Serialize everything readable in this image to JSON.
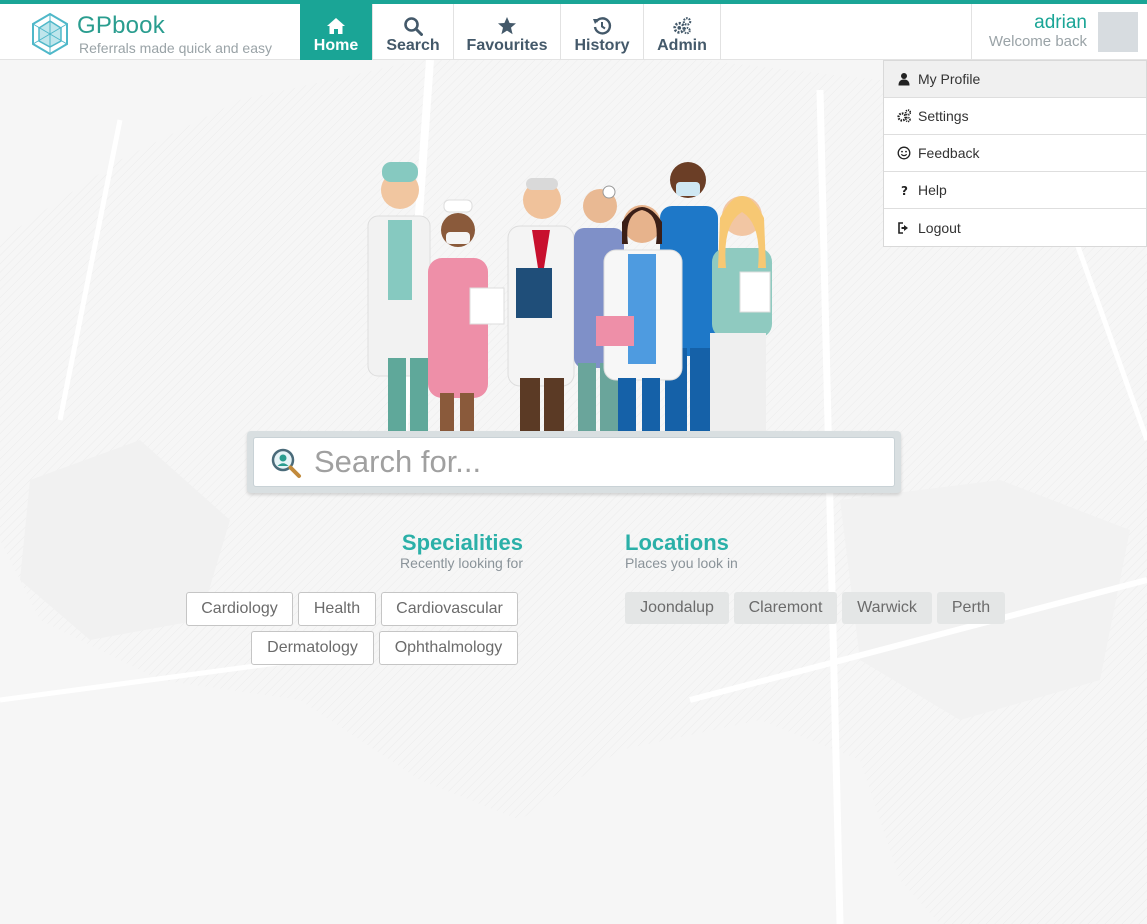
{
  "brand": {
    "name": "GPbook",
    "tagline": "Referrals made quick and easy"
  },
  "nav": {
    "items": [
      {
        "label": "Home",
        "icon": "home-icon",
        "active": true
      },
      {
        "label": "Search",
        "icon": "search-icon"
      },
      {
        "label": "Favourites",
        "icon": "star-icon"
      },
      {
        "label": "History",
        "icon": "history-icon"
      },
      {
        "label": "Admin",
        "icon": "gears-icon"
      }
    ]
  },
  "user": {
    "name": "adrian",
    "welcome": "Welcome back"
  },
  "user_menu": {
    "items": [
      {
        "label": "My Profile",
        "icon": "user-icon"
      },
      {
        "label": "Settings",
        "icon": "settings-icon"
      },
      {
        "label": "Feedback",
        "icon": "smile-icon"
      },
      {
        "label": "Help",
        "icon": "help-icon"
      },
      {
        "label": "Logout",
        "icon": "logout-icon"
      }
    ]
  },
  "search": {
    "placeholder": "Search for..."
  },
  "specialities": {
    "title": "Specialities",
    "subtitle": "Recently looking for",
    "items": [
      "Cardiology",
      "Health",
      "Cardiovascular",
      "Dermatology",
      "Ophthalmology"
    ]
  },
  "locations": {
    "title": "Locations",
    "subtitle": "Places you look in",
    "items": [
      "Joondalup",
      "Claremont",
      "Warwick",
      "Perth"
    ]
  },
  "colors": {
    "accent": "#1aa596",
    "nav_text": "#44596a",
    "section_title": "#2bb0a8"
  }
}
